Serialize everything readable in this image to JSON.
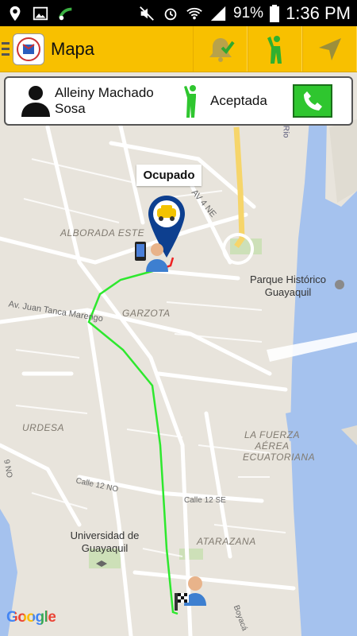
{
  "status_bar": {
    "battery": "91%",
    "time": "1:36 PM"
  },
  "app_bar": {
    "title": "Mapa",
    "icons": [
      "bell-check-icon",
      "person-walking-icon",
      "navigation-arrow-icon"
    ]
  },
  "passenger_card": {
    "name": "Alleiny Machado Sosa",
    "status": "Aceptada"
  },
  "map": {
    "marker_label": "Ocupado",
    "street_labels": {
      "av4ne": "AV 4 NE",
      "tanca": "Av. Juan Tanca Marengo",
      "calle12no": "Calle 12 NO",
      "calle12se": "Calle 12 SE",
      "nono": "9 NO",
      "rio": "Río",
      "boyaca": "Boyacá"
    },
    "district_labels": {
      "alborada": "ALBORADA ESTE",
      "garzota": "GARZOTA",
      "urdesa": "URDESA",
      "fuerza": "LA FUERZA AÉREA ECUATORIANA",
      "atarazana": "ATARAZANA"
    },
    "poi_labels": {
      "parque": "Parque Histórico Guayaquil",
      "universidad": "Universidad de Guayaquil"
    },
    "attribution": "Google"
  }
}
